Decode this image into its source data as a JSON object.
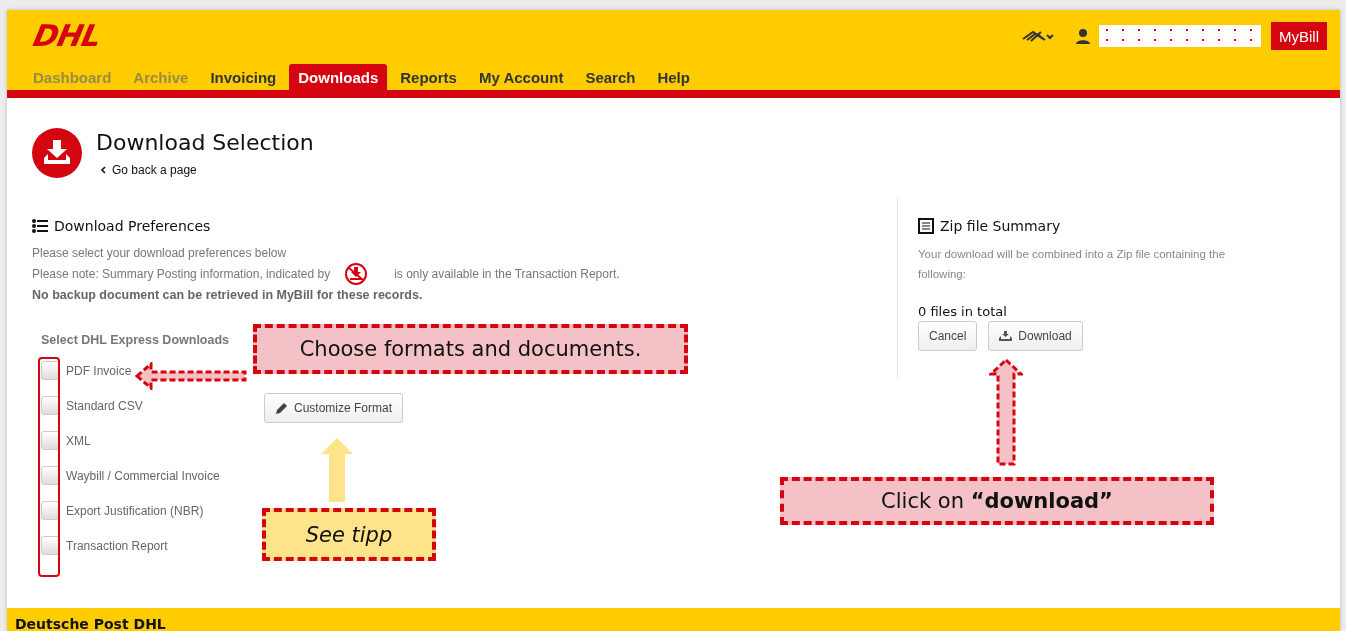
{
  "header": {
    "logo": "DHL",
    "user_field": {
      "kind": "masked"
    },
    "app_button": "MyBill"
  },
  "tabs": [
    {
      "label": "Dashboard",
      "selected": false,
      "disabled": true
    },
    {
      "label": "Archive",
      "selected": false,
      "disabled": true
    },
    {
      "label": "Invoicing",
      "selected": false,
      "disabled": false
    },
    {
      "label": "Downloads",
      "selected": true,
      "disabled": false
    },
    {
      "label": "Reports",
      "selected": false,
      "disabled": false
    },
    {
      "label": "My Account",
      "selected": false,
      "disabled": false
    },
    {
      "label": "Search",
      "selected": false,
      "disabled": false
    },
    {
      "label": "Help",
      "selected": false,
      "disabled": false
    }
  ],
  "page": {
    "title": "Download Selection",
    "back_link": "Go back a page"
  },
  "preferences": {
    "heading": "Download Preferences",
    "intro": "Please select your download preferences below",
    "note_before": "Please note: Summary Posting information, indicated by",
    "note_after": "is only available in the Transaction Report.",
    "warning": "No backup document can be retrieved in MyBill for these records.",
    "group_label": "Select DHL Express Downloads",
    "options": [
      {
        "label": "PDF Invoice",
        "checked": false
      },
      {
        "label": "Standard CSV",
        "checked": false
      },
      {
        "label": "XML",
        "checked": false
      },
      {
        "label": "Waybill / Commercial Invoice",
        "checked": false
      },
      {
        "label": "Export Justification (NBR)",
        "checked": false
      },
      {
        "label": "Transaction Report",
        "checked": false
      }
    ],
    "customize_button": "Customize Format"
  },
  "summary": {
    "heading": "Zip file Summary",
    "description": "Your download will be combined into a Zip file containing the following:",
    "total": "0 files in total",
    "buttons": [
      "Cancel",
      "Download"
    ]
  },
  "annotations": [
    {
      "kind": "pink",
      "text": "Choose formats and documents."
    },
    {
      "kind": "yellow",
      "text": "See tipp"
    },
    {
      "kind": "pink",
      "text": "Click on **“download”**"
    }
  ],
  "footer": {
    "text": "Deutsche Post DHL"
  }
}
